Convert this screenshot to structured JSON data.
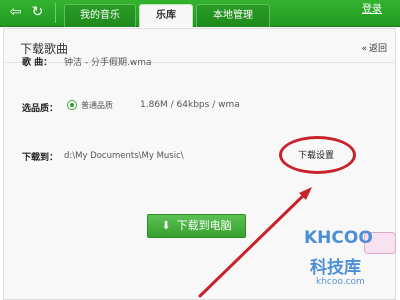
{
  "topbar": {
    "tabs": [
      {
        "label": "我的音乐"
      },
      {
        "label": "乐库"
      },
      {
        "label": "本地管理"
      }
    ],
    "login_label": "登录"
  },
  "panel": {
    "title": "下载歌曲",
    "back_label": "返回"
  },
  "form": {
    "song_label": "歌 曲：",
    "song_value": "钟洁 - 分手假期.wma",
    "quality_label": "选品质：",
    "quality_option": "普通品质",
    "quality_info": "1.86M / 64kbps / wma",
    "dest_label": "下载到：",
    "dest_path": "d:\\My Documents\\My Music\\",
    "settings_label": "下载设置"
  },
  "download_button": {
    "label": "下载到电脑"
  },
  "watermark": {
    "logo": "KHCOO",
    "cn": "科技库",
    "url": "khcoo.com"
  },
  "colors": {
    "accent_green": "#2aa227",
    "annotation_red": "#c8232b",
    "watermark_blue": "#4d8fd6"
  }
}
